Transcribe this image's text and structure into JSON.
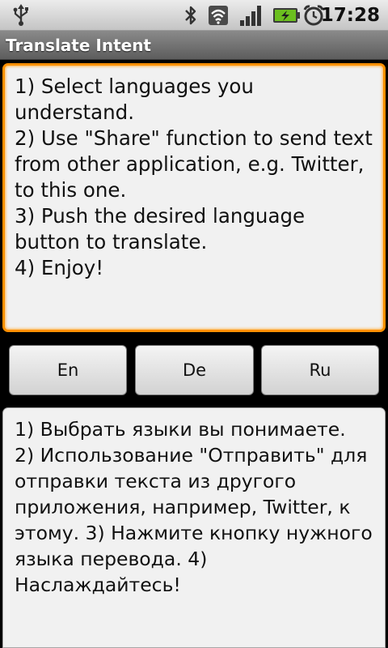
{
  "status_bar": {
    "time": "17:28",
    "icons": [
      "usb-icon",
      "bluetooth-icon",
      "wifi-icon",
      "signal-icon",
      "battery-charging-icon",
      "alarm-clock-icon"
    ],
    "battery_color": "#6bbf1f"
  },
  "title_bar": {
    "title": "Translate Intent"
  },
  "source": {
    "text": "1) Select languages you understand.\n2) Use \"Share\" function to send text from other application, e.g. Twitter, to this one.\n3) Push the desired language button to translate.\n4) Enjoy!"
  },
  "buttons": [
    {
      "label": "En"
    },
    {
      "label": "De"
    },
    {
      "label": "Ru"
    }
  ],
  "translation": {
    "text": "1) Выбрать языки вы понимаете.\n2) Использование \"Отправить\" для отправки текста из другого приложения, например, Twitter, к этому. 3) Нажмите кнопку нужного языка перевода. 4) Наслаждайтесь!"
  },
  "colors": {
    "focus_border": "#ff9000",
    "field_bg": "#f1f1f1"
  }
}
